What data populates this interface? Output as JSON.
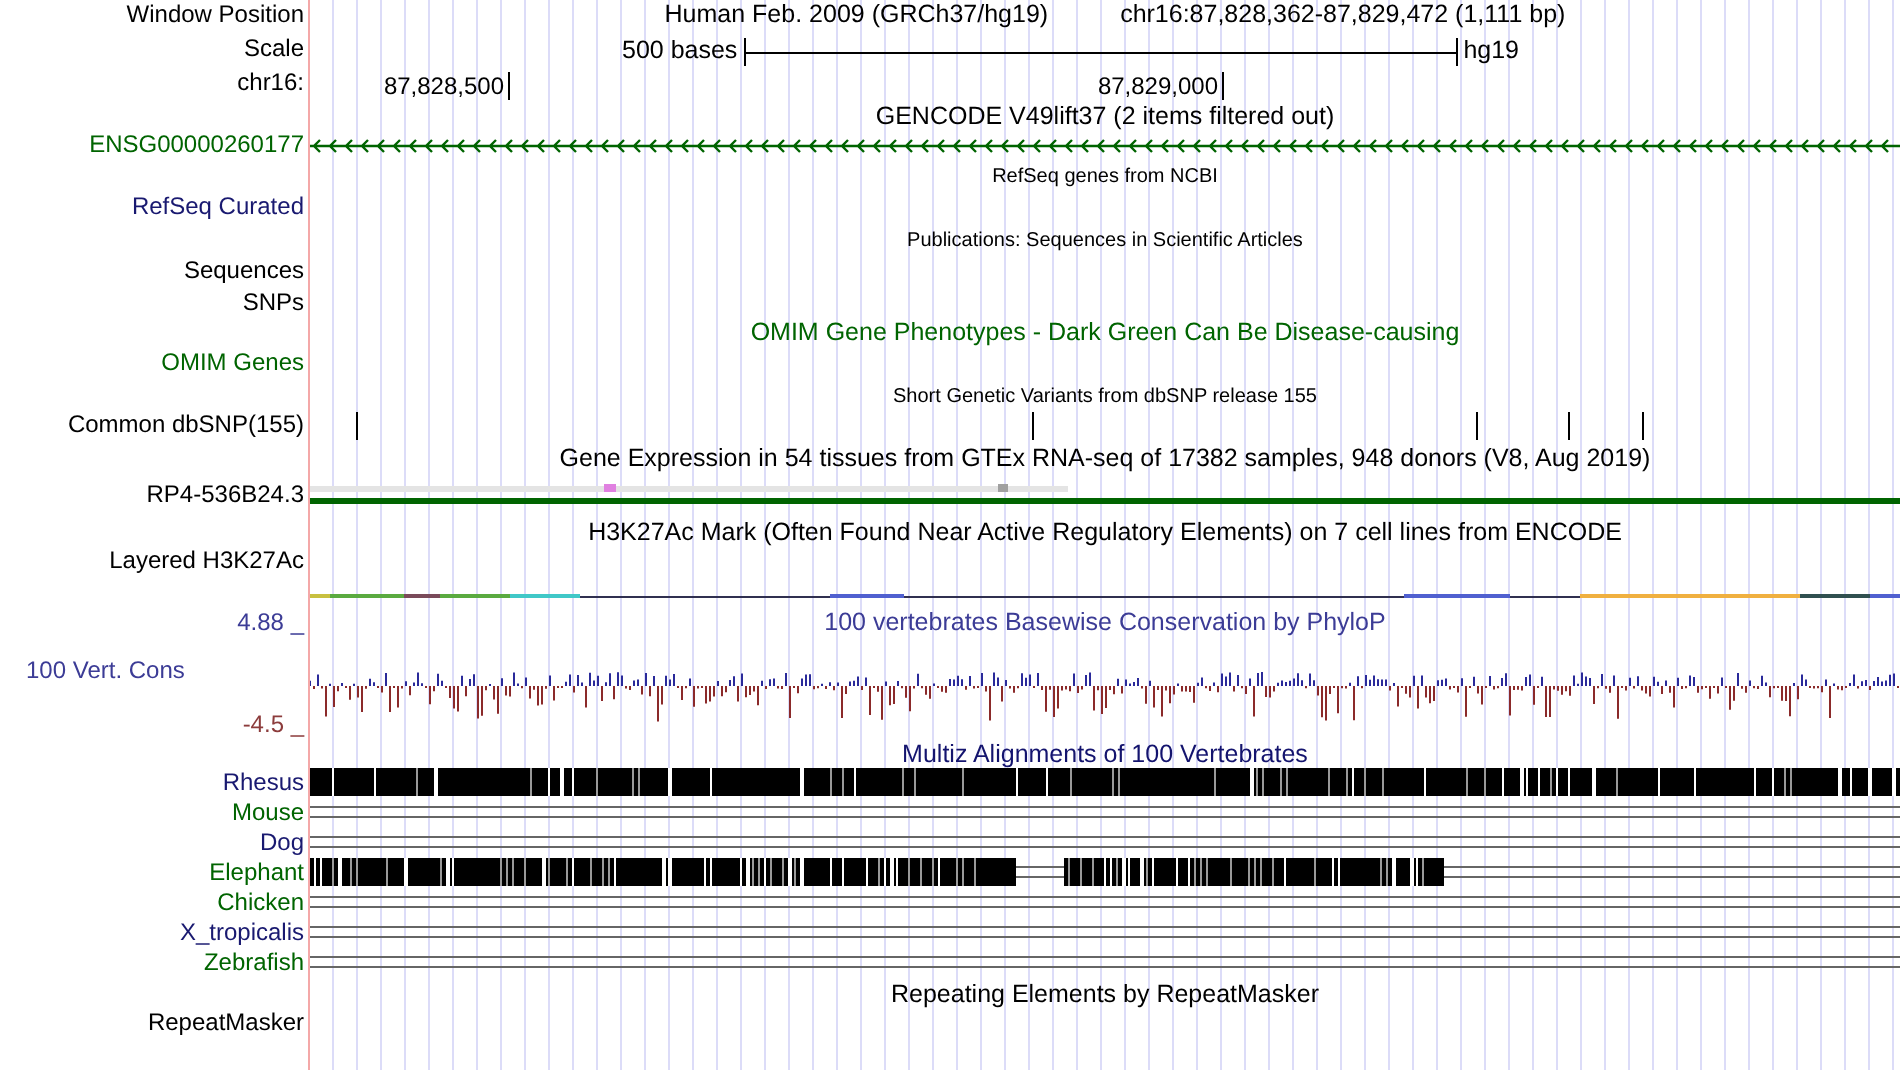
{
  "window_position": {
    "label": "Window Position",
    "assembly": "Human Feb. 2009 (GRCh37/hg19)",
    "range": "chr16:87,828,362-87,829,472 (1,111 bp)"
  },
  "scale": {
    "label": "Scale",
    "bases": "500 bases",
    "assembly": "hg19"
  },
  "coordinates": {
    "label": "chr16:",
    "ticks": [
      "87,828,500",
      "87,829,000"
    ]
  },
  "tracks": [
    {
      "kind": "gene",
      "title": "GENCODE V49lift37 (2 items filtered out)",
      "label": "ENSG00000260177",
      "color": "#006400"
    },
    {
      "kind": "refseq",
      "title": "RefSeq genes from NCBI",
      "label": "RefSeq Curated",
      "color": "#191970"
    },
    {
      "kind": "publications",
      "title": "Publications: Sequences in Scientific Articles",
      "labels": [
        "Sequences",
        "SNPs"
      ]
    },
    {
      "kind": "omim",
      "title": "OMIM Gene Phenotypes - Dark Green Can Be Disease-causing",
      "label": "OMIM Genes",
      "color": "#006400"
    },
    {
      "kind": "snp",
      "title": "Short Genetic Variants from dbSNP release 155",
      "label": "Common dbSNP(155)"
    },
    {
      "kind": "gtex",
      "title": "Gene Expression in 54 tissues from GTEx RNA-seq of 17382 samples, 948 donors (V8, Aug 2019)",
      "label": "RP4-536B24.3"
    },
    {
      "kind": "h3k27ac",
      "title": "H3K27Ac Mark (Often Found Near Active Regulatory Elements) on 7 cell lines from ENCODE",
      "label": "Layered H3K27Ac"
    },
    {
      "kind": "phylop",
      "title": "100 vertebrates Basewise Conservation by PhyloP",
      "label": "100 Vert. Cons",
      "max": "4.88 _",
      "min": "-4.5 _"
    },
    {
      "kind": "multiz",
      "title": "Multiz Alignments of 100 Vertebrates",
      "species": [
        {
          "name": "Rhesus",
          "color": "#191970",
          "kind": "block"
        },
        {
          "name": "Mouse",
          "color": "#006400",
          "kind": "lines"
        },
        {
          "name": "Dog",
          "color": "#191970",
          "kind": "lines"
        },
        {
          "name": "Elephant",
          "color": "#006400",
          "kind": "partial"
        },
        {
          "name": "Chicken",
          "color": "#006400",
          "kind": "lines"
        },
        {
          "name": "X_tropicalis",
          "color": "#191970",
          "kind": "lines"
        },
        {
          "name": "Zebrafish",
          "color": "#006400",
          "kind": "lines"
        }
      ]
    },
    {
      "kind": "repeatmasker",
      "title": "Repeating Elements by RepeatMasker",
      "label": "RepeatMasker"
    }
  ]
}
